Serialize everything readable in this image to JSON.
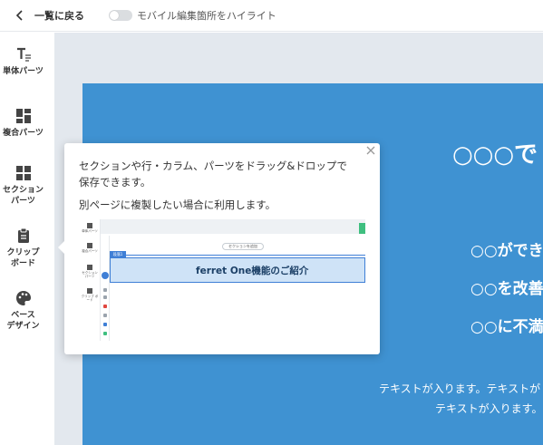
{
  "topbar": {
    "back_label": "一覧に戻る",
    "toggle_label": "モバイル編集箇所をハイライト",
    "toggle_on": false
  },
  "sidebar": {
    "items": [
      {
        "label": "単体パーツ",
        "icon": "text-format-icon"
      },
      {
        "label": "複合パーツ",
        "icon": "grid-icon"
      },
      {
        "label": "セクション\nパーツ",
        "label_lines": [
          "セクション",
          "パーツ"
        ],
        "icon": "section-layout-icon"
      },
      {
        "label": "クリップ\nボード",
        "label_lines": [
          "クリップ",
          "ボード"
        ],
        "icon": "clipboard-icon"
      },
      {
        "label": "ベース\nデザイン",
        "label_lines": [
          "ベース",
          "デザイン"
        ],
        "icon": "palette-icon"
      }
    ]
  },
  "tooltip": {
    "line1": "セクションや行・カラム、パーツをドラッグ&ドロップで",
    "line2": "保存できます。",
    "line3": "別ページに複製したい場合に利用します。",
    "close_icon": "close-icon",
    "image": {
      "side_labels": [
        "単体パーツ",
        "複合パーツ",
        "セクション\nパーツ",
        "クリップ\nボード"
      ],
      "tag_label": "段落1",
      "pill_label": "セクションを追加",
      "heading": "ferret One機能のご紹介"
    }
  },
  "hero": {
    "title": "○○○で",
    "lines": [
      "○○ができ",
      "○○を改善",
      "○○に不満"
    ],
    "text1": "テキストが入ります。テキストが",
    "text2": "テキストが入ります。"
  },
  "colors": {
    "hero_bg": "#3f92d2",
    "canvas_bg": "#e3e8ee",
    "accent": "#3f7fd6",
    "highlight": "#cfe3f7"
  }
}
